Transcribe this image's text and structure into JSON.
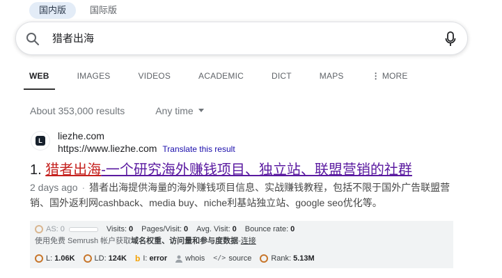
{
  "region": {
    "options": [
      "国内版",
      "国际版"
    ],
    "selected": "国内版"
  },
  "search": {
    "query": "猎者出海"
  },
  "tabs": [
    {
      "label": "WEB",
      "active": true
    },
    {
      "label": "IMAGES"
    },
    {
      "label": "VIDEOS"
    },
    {
      "label": "ACADEMIC"
    },
    {
      "label": "DICT"
    },
    {
      "label": "MAPS"
    },
    {
      "label": "MORE"
    }
  ],
  "results_info": {
    "count": "About 353,000 results",
    "time_filter": "Any time"
  },
  "result": {
    "site": "liezhe.com",
    "url": "https://www.liezhe.com",
    "translate": "Translate this result",
    "number": "1.",
    "title_highlight": "猎者出海",
    "title_rest": "-一个研究海外赚钱项目、独立站、联盟营销的社群",
    "date": "2 days ago",
    "snippet": "猎者出海提供海量的海外赚钱项目信息、实战赚钱教程，包括不限于国外广告联盟营销、国外返利网cashback、media buy、niche利基站独立站、google seo优化等。"
  },
  "semrush": {
    "as_label": "AS:",
    "as_value": "0",
    "visits_label": "Visits:",
    "visits_value": "0",
    "pages_label": "Pages/Visit:",
    "pages_value": "0",
    "avg_label": "Avg. Visit:",
    "avg_value": "0",
    "bounce_label": "Bounce rate:",
    "bounce_value": "0",
    "promo_prefix": "使用免费 Semrush 帐户获取",
    "promo_bold": "域名权重、访问量和参与度数据",
    "promo_sep": " - ",
    "promo_link": "连接",
    "l_label": "L:",
    "l_value": "1.06K",
    "ld_label": "LD:",
    "ld_value": "124K",
    "i_label": "I:",
    "i_value": "error",
    "whois": "whois",
    "source": "source",
    "rank_label": "Rank:",
    "rank_value": "5.13M"
  },
  "colors": {
    "link": "#1a0dab",
    "visited": "#5a1aa0",
    "highlight": "#c5221f",
    "ring": "#c7762b"
  }
}
